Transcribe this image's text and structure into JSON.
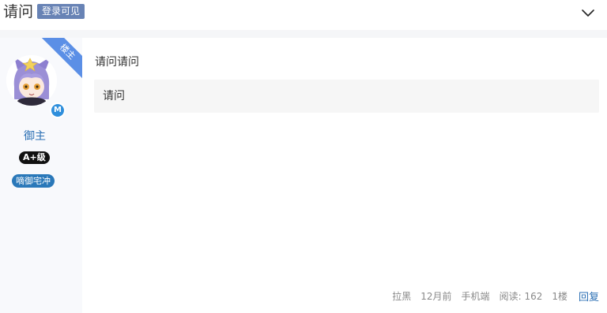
{
  "header": {
    "title": "请问",
    "badge": "登录可见"
  },
  "author": {
    "ribbon": "楼主",
    "name": "御主",
    "level": "A+级",
    "group": "嘀御宅冲",
    "verified_mark": "M"
  },
  "post": {
    "text": "请问请问",
    "quote": "请问"
  },
  "meta": {
    "block": "拉黑",
    "time": "12月前",
    "device": "手机端",
    "reads_label": "阅读:",
    "reads": "162",
    "floor": "1楼",
    "reply": "回复"
  },
  "icons": {
    "collapse": "chevron-down-icon",
    "avatar": "anime-avatar"
  }
}
